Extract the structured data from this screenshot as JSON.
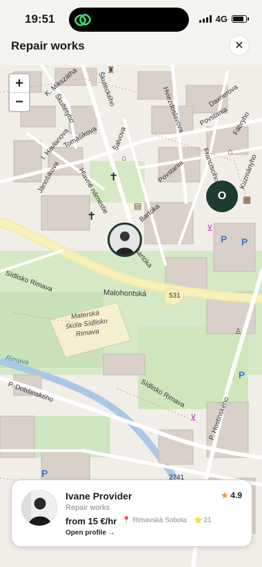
{
  "status_bar": {
    "time": "19:51",
    "network": "4G"
  },
  "header": {
    "title": "Repair works",
    "close_icon": "close-icon"
  },
  "map": {
    "zoom_in": "+",
    "zoom_out": "−",
    "cluster_label": "O",
    "street_labels": {
      "malohontska": "Malohontská",
      "road_number": "531",
      "road_number_2": "2741",
      "school": "Materská škola Sídlisko Rimava",
      "school_line1": "Materská",
      "school_line2": "škola Sídlisko",
      "school_line3": "Rimava",
      "rimava": "Rimava",
      "sidlisko_rimava": "Sídlisko Rimava",
      "sidlisko_rimava_2": "Sídlisko Rimava",
      "dobsinskeho": "P. Dobšinského",
      "hostinskeho": "P. Hostinského",
      "povstania": "Povstania",
      "salvova": "Šalvova",
      "tomasikova": "Tomášikova",
      "janoskova": "Jánošíkova",
      "hlavne_namestie": "Hlavné námestie",
      "hviezdoslavova": "Hviezdoslavova",
      "daxnerova": "Daxnerova",
      "fabryho": "Fábryho",
      "bartoka": "Bartóka",
      "bartoka_2": "Bartóka",
      "skuteckeho": "Škuteckého",
      "skultetyho": "Škultétyho",
      "mikszatha": "K. Mikszátha",
      "havlanova": "I. Havlanova",
      "francisciho": "Francisciho",
      "kuzminyho": "Kuzmányho",
      "povstania_2": "Povstania"
    }
  },
  "provider_card": {
    "name": "Ivane Provider",
    "role": "Repair works",
    "price": "from 15 €/hr",
    "location": "Rimavská Sobota",
    "reviews": "21",
    "rating": "4.9",
    "open_profile": "Open profile →"
  },
  "colors": {
    "accent": "#1e3b2f",
    "star": "#d8a03a"
  }
}
